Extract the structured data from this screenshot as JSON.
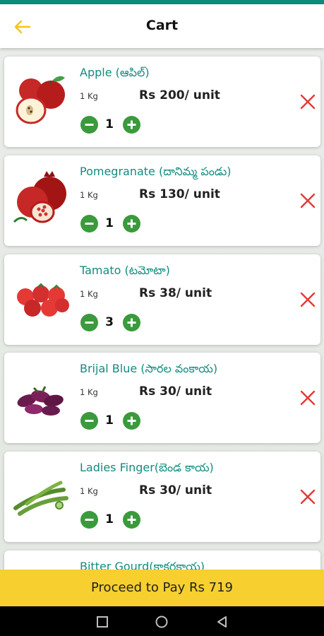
{
  "header": {
    "title": "Cart",
    "back_icon": "back-arrow-icon",
    "accent": "#f5c518"
  },
  "items": [
    {
      "name": "Apple (ఆపిల్)",
      "unit": "1 Kg",
      "price": "Rs 200/ unit",
      "qty": "1",
      "image": "apple"
    },
    {
      "name": "Pomegranate (దానిమ్మ పండు)",
      "unit": "1 Kg",
      "price": "Rs 130/ unit",
      "qty": "1",
      "image": "pomegranate"
    },
    {
      "name": "Tamato (టమోటా)",
      "unit": "1 Kg",
      "price": "Rs 38/ unit",
      "qty": "3",
      "image": "tomato"
    },
    {
      "name": "Brijal Blue (సారల వంకాయ)",
      "unit": "1 Kg",
      "price": "Rs 30/ unit",
      "qty": "1",
      "image": "brinjal"
    },
    {
      "name": "Ladies Finger(బెండ కాయ)",
      "unit": "1 Kg",
      "price": "Rs 30/ unit",
      "qty": "1",
      "image": "okra"
    },
    {
      "name": "Bitter Gourd(కాకరకాయ)"
    }
  ],
  "footer": {
    "pay_label": "Proceed to Pay Rs 719"
  },
  "colors": {
    "status_bar": "#0c8a7a",
    "product_name": "#128c7e",
    "qty_button": "#3a9a3c",
    "remove": "#e53935",
    "pay_bar": "#f7cf2e"
  }
}
